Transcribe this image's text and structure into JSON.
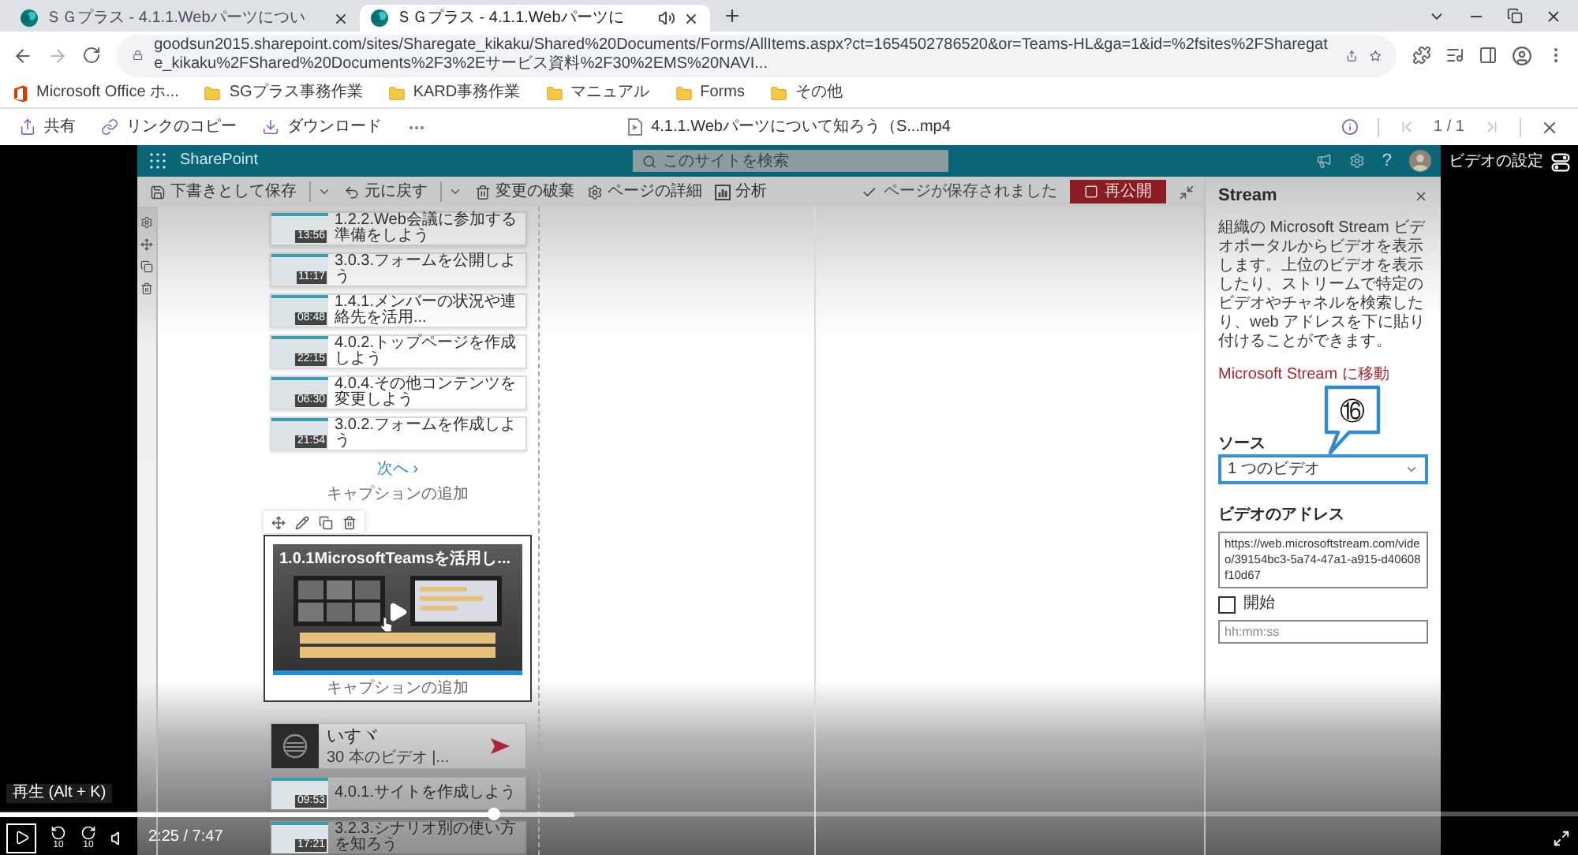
{
  "browser": {
    "tabs": [
      {
        "title": "ＳＧプラス - 4.1.1.Webパーツについ",
        "selected": false,
        "audio": false
      },
      {
        "title": "ＳＧプラス - 4.1.1.Webパーツに",
        "selected": true,
        "audio": true
      }
    ],
    "nav": {
      "back_disabled": false,
      "forward_disabled": true
    },
    "url": "goodsun2015.sharepoint.com/sites/Sharegate_kikaku/Shared%20Documents/Forms/AllItems.aspx?ct=1654502786520&or=Teams-HL&ga=1&id=%2fsites%2FSharegate_kikaku%2FShared%20Documents%2F3%2Eサービス資料%2F30%2EMS%20NAVI...",
    "bookmarks": [
      {
        "kind": "office",
        "label": "Microsoft Office ホ..."
      },
      {
        "kind": "folder",
        "label": "SGプラス事務作業"
      },
      {
        "kind": "folder",
        "label": "KARD事務作業"
      },
      {
        "kind": "folder",
        "label": "マニュアル"
      },
      {
        "kind": "folder",
        "label": "Forms"
      },
      {
        "kind": "folder",
        "label": "その他"
      }
    ]
  },
  "viewer": {
    "actions": [
      {
        "kind": "share",
        "label": "共有"
      },
      {
        "kind": "link",
        "label": "リンクのコピー"
      },
      {
        "kind": "download",
        "label": "ダウンロード"
      }
    ],
    "file_name": "4.1.1.Webパーツについて知ろう（S...mp4",
    "page": "1 / 1",
    "previous_disabled": true,
    "next_disabled": true
  },
  "video": {
    "sharepoint": {
      "app_name": "SharePoint",
      "search_placeholder": "このサイトを検索",
      "help": "?"
    },
    "command_bar": {
      "items": [
        {
          "kind": "save",
          "label": "下書きとして保存",
          "menu": true
        },
        {
          "kind": "undo",
          "label": "元に戻す",
          "menu": true
        },
        {
          "kind": "discard",
          "label": "変更の破棄",
          "menu": false
        },
        {
          "kind": "details",
          "label": "ページの詳細",
          "menu": false
        },
        {
          "kind": "analytics",
          "label": "分析",
          "menu": false
        }
      ],
      "status": "ページが保存されました",
      "publish": "再公開"
    },
    "canvas": {
      "videos": [
        {
          "title": "1.2.2.Web会議に参加する準備をしよう",
          "duration": "13:56"
        },
        {
          "title": "3.0.3.フォームを公開しよう",
          "duration": "11:17"
        },
        {
          "title": "1.4.1.メンバーの状況や連絡先を活用...",
          "duration": "08:48"
        },
        {
          "title": "4.0.2.トップページを作成しよう",
          "duration": "22:15"
        },
        {
          "title": "4.0.4.その他コンテンツを変更しよう",
          "duration": "06:30"
        },
        {
          "title": "3.0.2.フォームを作成しよう",
          "duration": "21:54"
        }
      ],
      "next": "次へ ›",
      "caption_placeholder": "キャプションの追加",
      "selected_webpart": {
        "title": "1.0.1MicrosoftTeamsを活用し...",
        "caption": "キャプションの追加"
      },
      "channel": {
        "title": "いすヾ",
        "subtitle": "30 本のビデオ |..."
      },
      "more_videos": [
        {
          "title": "4.0.1.サイトを作成しよう",
          "duration": "09:53"
        },
        {
          "title": "3.2.3.シナリオ別の使い方を知ろう",
          "duration": "17:21"
        }
      ]
    },
    "property_pane": {
      "title": "Stream",
      "description": "組織の Microsoft Stream ビデオポータルからビデオを表示します。上位のビデオを表示したり、ストリームで特定のビデオやチャネルを検索したり、web アドレスを下に貼り付けることができます。",
      "link": "Microsoft Stream に移動",
      "source_label": "ソース",
      "source_value": "1 つのビデオ",
      "address_label": "ビデオのアドレス",
      "address_value": "https://web.microsoftstream.com/video/39154bc3-5a74-47a1-a915-d40608f10d67",
      "start": {
        "label": "開始",
        "checked": false
      },
      "start_placeholder": "hh:mm:ss"
    },
    "callout": {
      "label": "⑯"
    }
  },
  "player": {
    "settings_label": "ビデオの設定",
    "tooltip": "再生 (Alt + K)",
    "progress": {
      "level": 0.313
    },
    "buffer": {
      "level": 0.364
    },
    "skip_back": "10",
    "skip_forward": "10",
    "time": "2:25 / 7:47"
  }
}
